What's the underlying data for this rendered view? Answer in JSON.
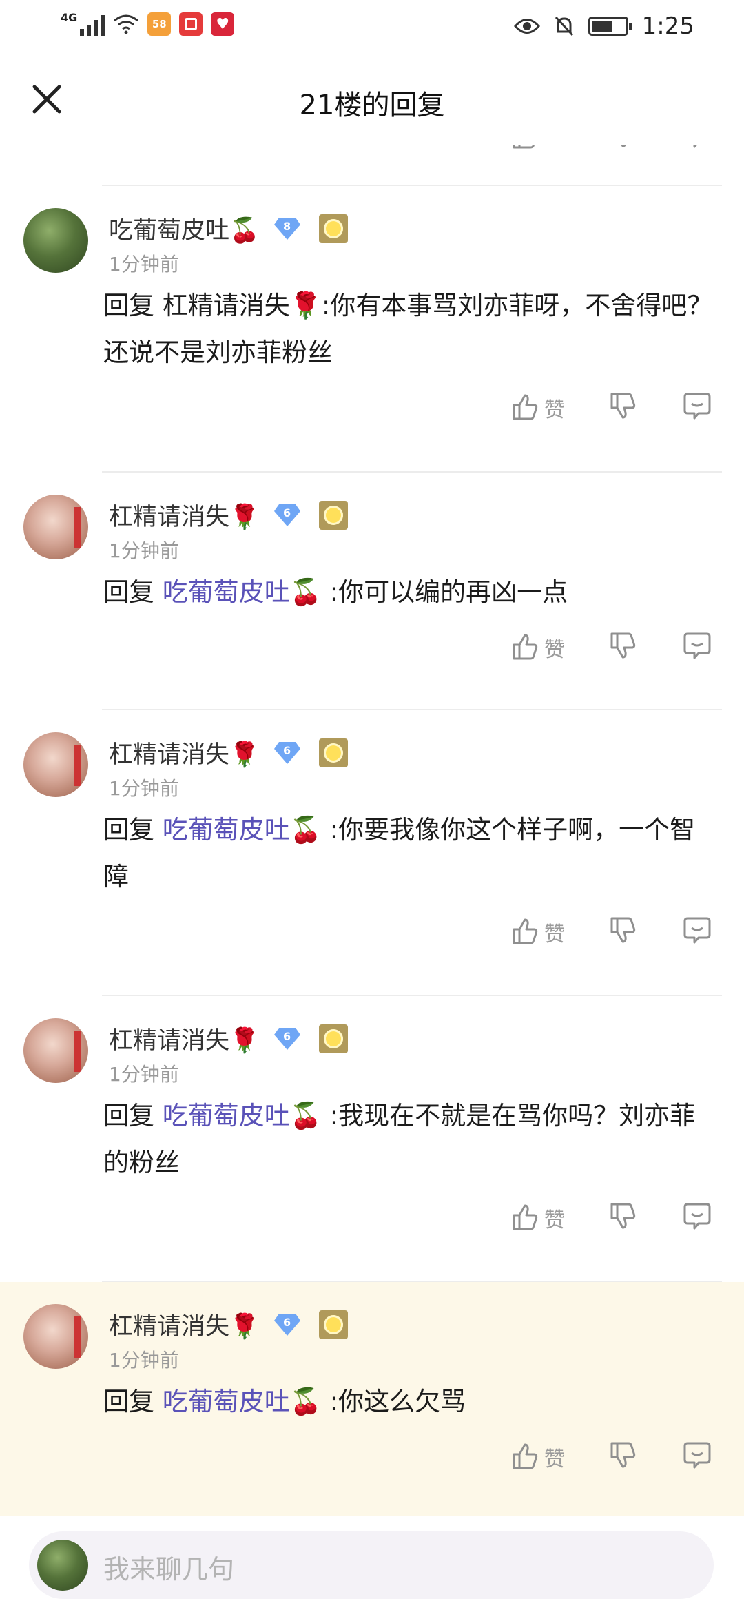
{
  "status_bar": {
    "network": "4G",
    "app_badges": [
      "58",
      "",
      ""
    ],
    "time": "1:25"
  },
  "header": {
    "title": "21楼的回复"
  },
  "actions": {
    "like_label": "赞"
  },
  "comments": [
    {
      "user": "吃葡萄皮吐🍒",
      "level": "8",
      "time": "1分钟前",
      "reply_prefix": "回复 ",
      "mention": "杠精请消失🌹",
      "text": ":你有本事骂刘亦菲呀，不舍得吧？还说不是刘亦菲粉丝"
    },
    {
      "user": "杠精请消失🌹",
      "level": "6",
      "time": "1分钟前",
      "reply_prefix": "回复 ",
      "mention": "吃葡萄皮吐🍒",
      "text": " :你可以编的再凶一点"
    },
    {
      "user": "杠精请消失🌹",
      "level": "6",
      "time": "1分钟前",
      "reply_prefix": "回复 ",
      "mention": "吃葡萄皮吐🍒",
      "text": " :你要我像你这个样子啊，一个智障"
    },
    {
      "user": "杠精请消失🌹",
      "level": "6",
      "time": "1分钟前",
      "reply_prefix": "回复 ",
      "mention": "吃葡萄皮吐🍒",
      "text": " :我现在不就是在骂你吗？刘亦菲的粉丝"
    },
    {
      "user": "杠精请消失🌹",
      "level": "6",
      "time": "1分钟前",
      "reply_prefix": "回复 ",
      "mention": "吃葡萄皮吐🍒",
      "text": " :你这么欠骂"
    }
  ],
  "input": {
    "placeholder": "我来聊几句"
  },
  "colors": {
    "mention": "#5a52b8",
    "highlight_bg": "#fdf8e8",
    "level_badge": "#6fa6f5"
  }
}
